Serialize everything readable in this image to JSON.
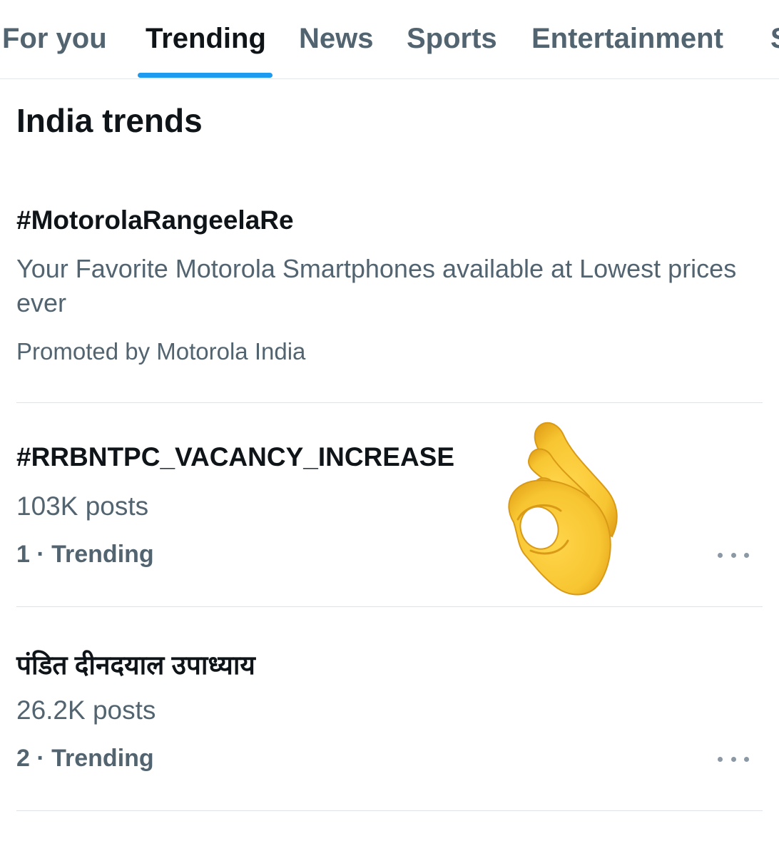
{
  "tabs": [
    {
      "label": "For you",
      "active": false
    },
    {
      "label": "Trending",
      "active": true
    },
    {
      "label": "News",
      "active": false
    },
    {
      "label": "Sports",
      "active": false
    },
    {
      "label": "Entertainment",
      "active": false
    },
    {
      "label": "S",
      "active": false
    }
  ],
  "section_title": "India trends",
  "trends": [
    {
      "title": "#MotorolaRangeelaRe",
      "description": "Your Favorite Motorola Smartphones available at Lowest prices ever",
      "promoted": "Promoted by Motorola India"
    },
    {
      "title": "#RRBNTPC_VACANCY_INCREASE",
      "posts": "103K posts",
      "rank": "1 · Trending"
    },
    {
      "title": "पंडित दीनदयाल उपाध्याय",
      "posts": "26.2K posts",
      "rank": "2 · Trending"
    }
  ],
  "emoji": {
    "icon": "ok-hand-emoji"
  },
  "colors": {
    "accent": "#1d9bf0",
    "text_primary": "#0f1419",
    "text_secondary": "#536471",
    "divider": "#dfe3e6"
  }
}
